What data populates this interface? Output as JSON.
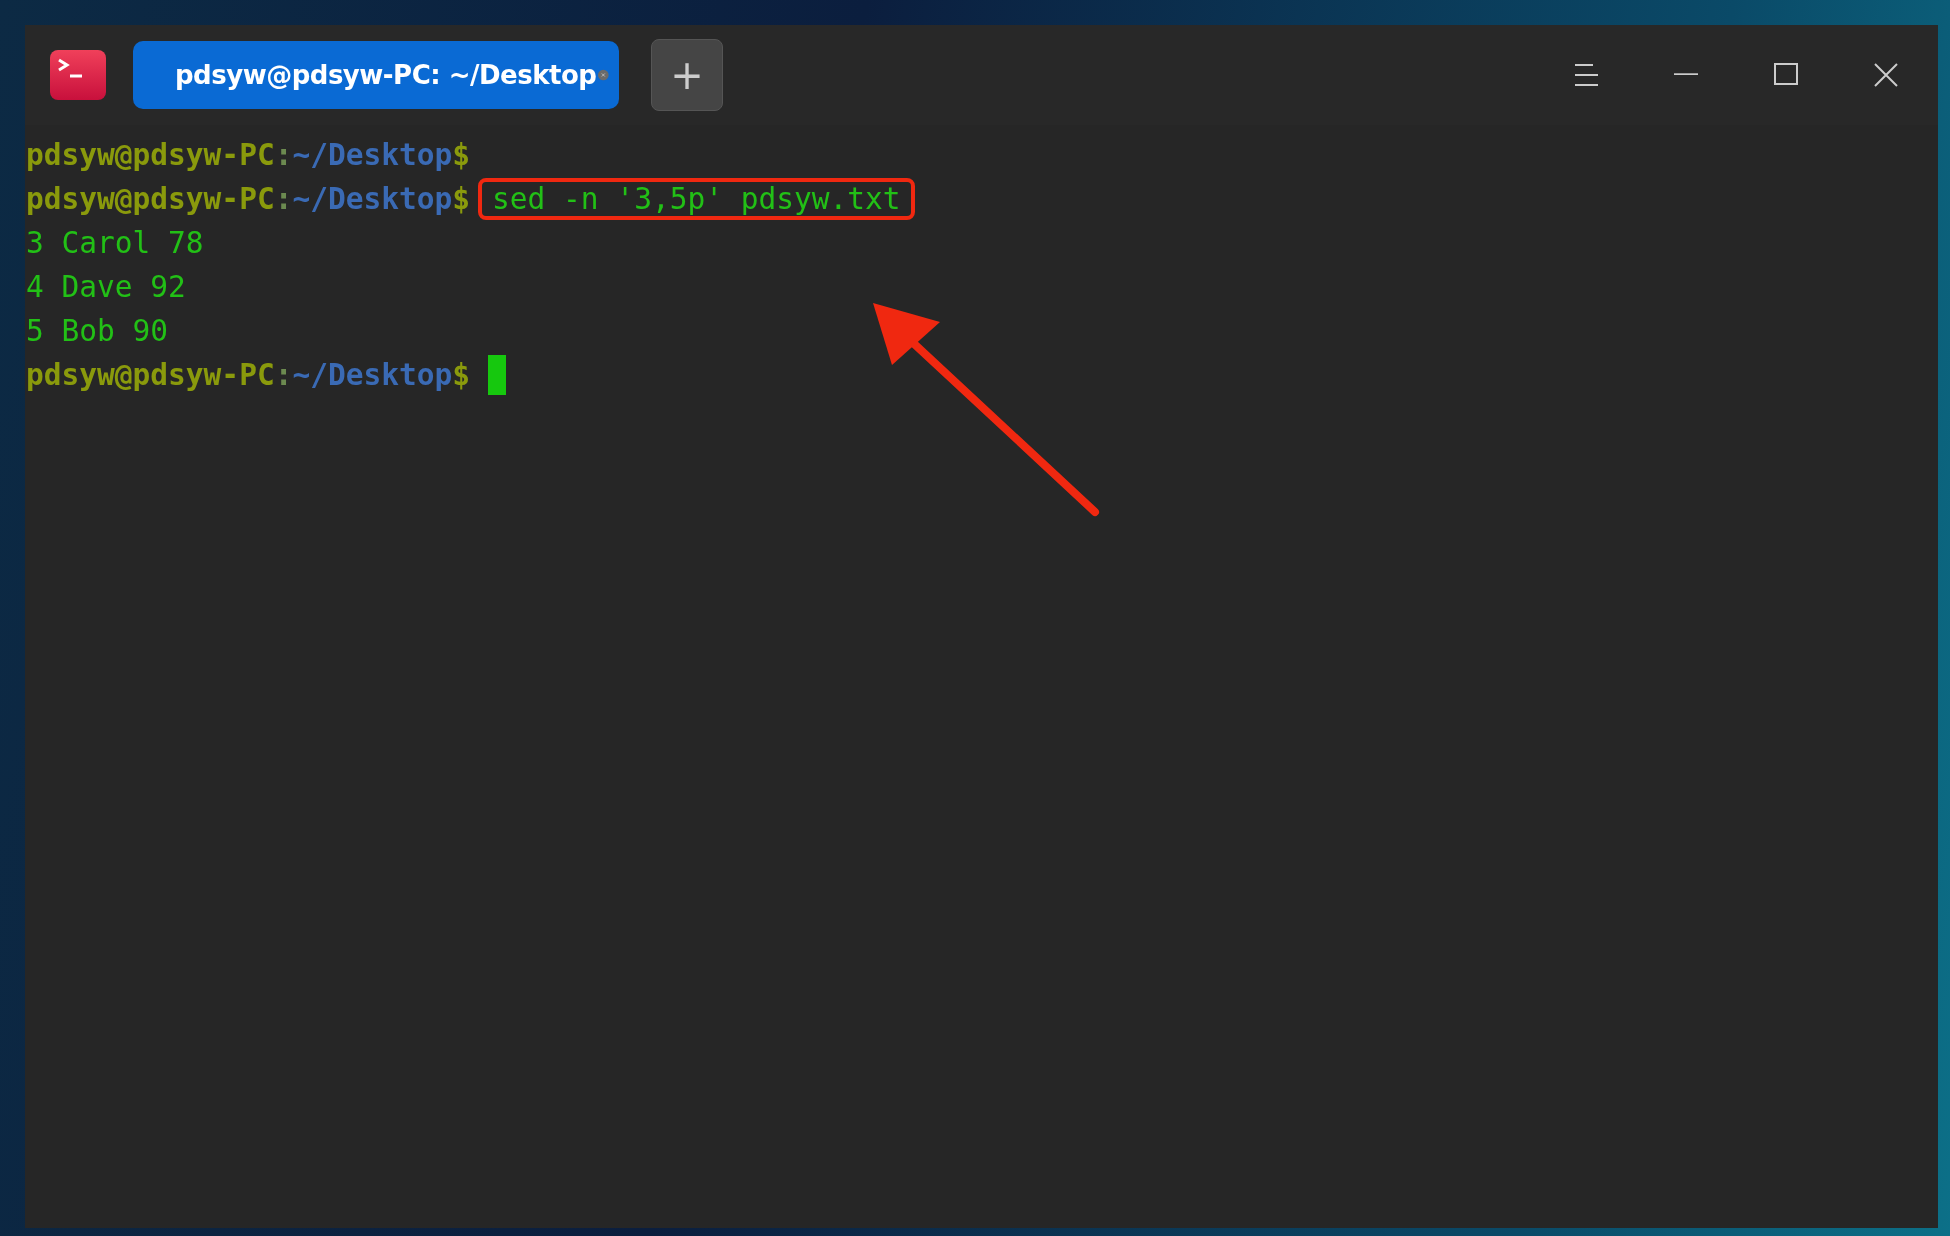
{
  "window": {
    "tab": {
      "title": "pdsyw@pdsyw-PC: ~/Desktop",
      "selected": true
    },
    "new_tab": "+"
  },
  "terminal": {
    "lines": [
      {
        "kind": "prompt",
        "user": "pdsyw@pdsyw-PC",
        "separator": ":",
        "path": "~/Desktop",
        "symbol": "$"
      },
      {
        "kind": "prompt",
        "user": "pdsyw@pdsyw-PC",
        "separator": ":",
        "path": "~/Desktop",
        "symbol": "$",
        "command": "sed -n '3,5p' pdsyw.txt",
        "highlighted": true
      },
      {
        "kind": "output",
        "text": "3 Carol 78"
      },
      {
        "kind": "output",
        "text": "4 Dave 92"
      },
      {
        "kind": "output",
        "text": "5 Bob 90"
      },
      {
        "kind": "prompt",
        "user": "pdsyw@pdsyw-PC",
        "separator": ":",
        "path": "~/Desktop",
        "symbol": "$",
        "cursor": true
      }
    ]
  }
}
